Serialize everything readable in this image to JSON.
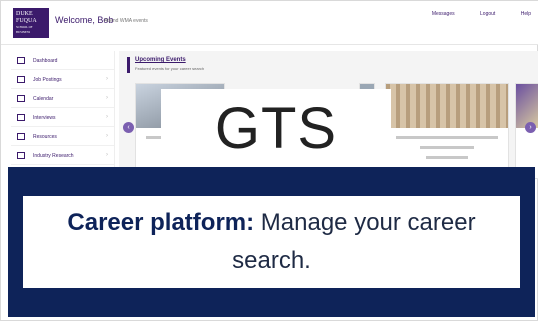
{
  "app": {
    "logo_lines": [
      "DUKE",
      "FUQUA",
      "SCHOOL OF BUSINESS"
    ],
    "welcome": "Welcome, Bob",
    "welcome_sub": "Attend WMA events"
  },
  "top_links": [
    "Messages",
    "Logout",
    "Help"
  ],
  "sidebar": {
    "items": [
      {
        "label": "Dashboard",
        "icon": "dashboard-icon"
      },
      {
        "label": "Job Postings",
        "icon": "briefcase-icon"
      },
      {
        "label": "Calendar",
        "icon": "calendar-icon"
      },
      {
        "label": "Interviews",
        "icon": "handshake-icon"
      },
      {
        "label": "Resources",
        "icon": "book-icon"
      },
      {
        "label": "Industry Research",
        "icon": "chart-icon"
      }
    ]
  },
  "main": {
    "section_title": "Upcoming Events",
    "section_sub": "Featured events for your career search"
  },
  "overlay": {
    "gts_label": "GTS"
  },
  "banner": {
    "bold": "Career platform:",
    "rest": " Manage your career search."
  },
  "colors": {
    "brand": "#3b1a6b",
    "banner_bg": "#0e2359",
    "banner_text": "#1e2a44"
  }
}
